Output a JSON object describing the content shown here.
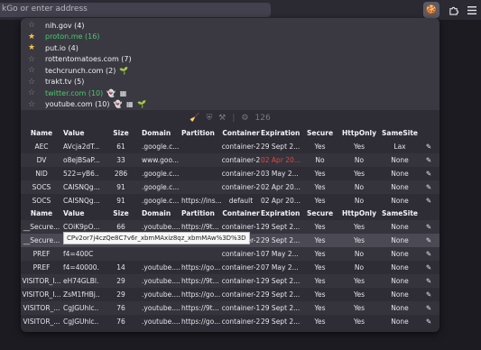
{
  "browser": {
    "url_placeholder": "kGo or enter address",
    "extension_icon": "cookie-icon",
    "menu_icon": "hamburger-icon"
  },
  "sites": [
    {
      "name": "nih.gov (4)",
      "starred": false,
      "green": false,
      "extra": ""
    },
    {
      "name": "proton.me (16)",
      "starred": true,
      "green": true,
      "extra": ""
    },
    {
      "name": "put.io (4)",
      "starred": true,
      "green": false,
      "extra": ""
    },
    {
      "name": "rottentomatoes.com (7)",
      "starred": false,
      "green": false,
      "extra": ""
    },
    {
      "name": "techcrunch.com (2)",
      "starred": false,
      "green": false,
      "extra": "🌱"
    },
    {
      "name": "trakt.tv (5)",
      "starred": false,
      "green": false,
      "extra": ""
    },
    {
      "name": "twitter.com (10)",
      "starred": false,
      "green": true,
      "extra": "👻 ▦"
    },
    {
      "name": "youtube.com (10)",
      "starred": false,
      "green": false,
      "extra": "👻 ▦ 🌱"
    }
  ],
  "toolbar": {
    "count": "126"
  },
  "table1": {
    "headers": [
      "Name",
      "Value",
      "Size",
      "Domain",
      "Partition",
      "Container",
      "Expiration",
      "Secure",
      "HttpOnly",
      "SameSite"
    ],
    "rows": [
      {
        "name": "AEC",
        "value": "AVcja2dT...",
        "size": "61",
        "domain": ".google.c...",
        "partition": "",
        "container": "container-2",
        "expiration": "29 Sept 2...",
        "secure": "Yes",
        "httponly": "Yes",
        "samesite": "Lax",
        "exp_red": false
      },
      {
        "name": "DV",
        "value": "o8ejBSaP...",
        "size": "33",
        "domain": "www.goo...",
        "partition": "",
        "container": "container-2",
        "expiration": "02 Apr 20...",
        "secure": "No",
        "httponly": "No",
        "samesite": "None",
        "exp_red": true
      },
      {
        "name": "NID",
        "value": "522=yB6...",
        "size": "286",
        "domain": ".google.c...",
        "partition": "",
        "container": "container-2",
        "expiration": "03 May 2...",
        "secure": "Yes",
        "httponly": "Yes",
        "samesite": "None",
        "exp_red": false
      },
      {
        "name": "SOCS",
        "value": "CAISNQg...",
        "size": "91",
        "domain": ".google.c...",
        "partition": "",
        "container": "container-2",
        "expiration": "02 Apr 20...",
        "secure": "Yes",
        "httponly": "No",
        "samesite": "None",
        "exp_red": false
      },
      {
        "name": "SOCS",
        "value": "CAISNQg...",
        "size": "91",
        "domain": ".google.c...",
        "partition": "https://ins...",
        "container": "default",
        "expiration": "02 Apr 20...",
        "secure": "Yes",
        "httponly": "No",
        "samesite": "None",
        "exp_red": false
      }
    ]
  },
  "table2": {
    "headers": [
      "Name",
      "Value",
      "Size",
      "Domain",
      "Partition",
      "Container",
      "Expiration",
      "Secure",
      "HttpOnly",
      "SameSite"
    ],
    "rows": [
      {
        "name": "__Secure...",
        "value": "COiK9pO...",
        "size": "66",
        "domain": ".youtube....",
        "partition": "https://9t...",
        "container": "container-1",
        "expiration": "29 Sept 2...",
        "secure": "Yes",
        "httponly": "Yes",
        "samesite": "None"
      },
      {
        "name": "__Secure...",
        "value": "CPv2or7j...",
        "size": "66",
        "domain": ".youtube....",
        "partition": "https://go...",
        "container": "container-2",
        "expiration": "29 Sept 2...",
        "secure": "Yes",
        "httponly": "Yes",
        "samesite": "None"
      },
      {
        "name": "PREF",
        "value": "f4=400C",
        "size": "",
        "domain": "",
        "partition": "",
        "container": "container-1",
        "expiration": "07 May 2...",
        "secure": "Yes",
        "httponly": "No",
        "samesite": "None"
      },
      {
        "name": "PREF",
        "value": "f4=40000...",
        "size": "14",
        "domain": ".youtube....",
        "partition": "https://go...",
        "container": "container-2",
        "expiration": "07 May 2...",
        "secure": "Yes",
        "httponly": "No",
        "samesite": "None"
      },
      {
        "name": "VISITOR_I...",
        "value": "eH74GLBl...",
        "size": "29",
        "domain": ".youtube....",
        "partition": "https://9t...",
        "container": "container-1",
        "expiration": "29 Sept 2...",
        "secure": "Yes",
        "httponly": "Yes",
        "samesite": "None"
      },
      {
        "name": "VISITOR_I...",
        "value": "ZsM1fHBj...",
        "size": "29",
        "domain": ".youtube....",
        "partition": "https://go...",
        "container": "container-2",
        "expiration": "29 Sept 2...",
        "secure": "Yes",
        "httponly": "Yes",
        "samesite": "None"
      },
      {
        "name": "VISITOR_...",
        "value": "CgJGUhlc...",
        "size": "76",
        "container": "container-1",
        "domain": ".youtube....",
        "partition": "https://9t...",
        "expiration": "29 Sept 2...",
        "secure": "Yes",
        "httponly": "Yes",
        "samesite": "None"
      },
      {
        "name": "VISITOR_...",
        "value": "CgJGUhlc...",
        "size": "76",
        "domain": ".youtube....",
        "partition": "https://go...",
        "container": "container-2",
        "expiration": "29 Sept 2...",
        "secure": "Yes",
        "httponly": "Yes",
        "samesite": "None"
      }
    ]
  },
  "tooltip": "CPv2or7j4czQe8C7v6r_xbmMAxiz8qz_xbmMAw%3D%3D"
}
